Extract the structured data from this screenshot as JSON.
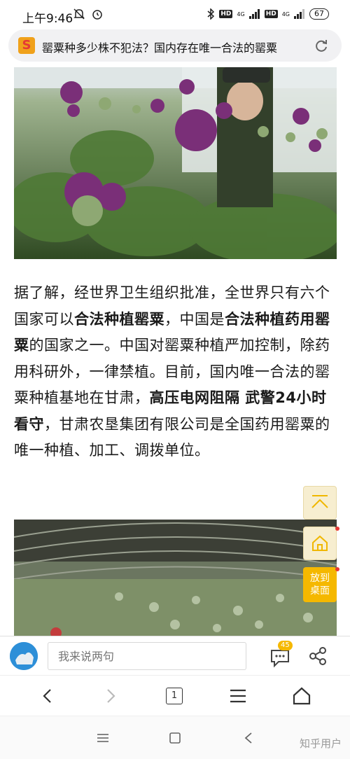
{
  "status_bar": {
    "time": "上午9:46",
    "network_label_1": "HD",
    "network_gen_1": "4G",
    "network_label_2": "HD",
    "network_gen_2": "4G",
    "battery": "67"
  },
  "address_bar": {
    "site_logo": "S",
    "page_title": "罂粟种多少株不犯法？国内存在唯一合法的罂粟"
  },
  "article": {
    "p1": "据了解，经世界卫生组织批准，全世界只有六个国家可以",
    "b1": "合法种植罂粟",
    "p2": "，中国是",
    "b2": "合法种植药用罂粟",
    "p3": "的国家之一。中国对罂粟种植严加控制，除药用科研外，一律禁植。目前，国内唯一合法的罂粟种植基地在甘肃，",
    "b3": "高压电网阻隔 武警24小时看守",
    "p4": "，甘肃农垦集团有限公司是全国药用罂粟的唯一种植、加工、调拨单位。"
  },
  "floating": {
    "desktop_line1": "放到",
    "desktop_line2": "桌面"
  },
  "comment_bar": {
    "placeholder": "我来说两句",
    "comment_count": "45"
  },
  "browser_nav": {
    "tab_count": "1"
  },
  "watermark": "知乎用户",
  "colors": {
    "accent": "#f5b800",
    "float_bg": "#f7eed0",
    "notification_dot": "#e53935"
  },
  "icons": {
    "status_left": [
      "mute-icon",
      "alarm-icon"
    ],
    "status_right": [
      "bluetooth-icon",
      "signal-icon",
      "battery-icon"
    ],
    "address": [
      "site-logo-icon",
      "reload-icon"
    ],
    "floating": [
      "scroll-top-icon",
      "home-icon"
    ],
    "comment_bar": [
      "avatar-icon",
      "comment-icon",
      "share-icon"
    ],
    "browser_nav": [
      "back-icon",
      "forward-icon",
      "tabs-icon",
      "menu-icon",
      "home-icon"
    ],
    "system_nav": [
      "recents-icon",
      "home-icon",
      "back-icon"
    ]
  }
}
